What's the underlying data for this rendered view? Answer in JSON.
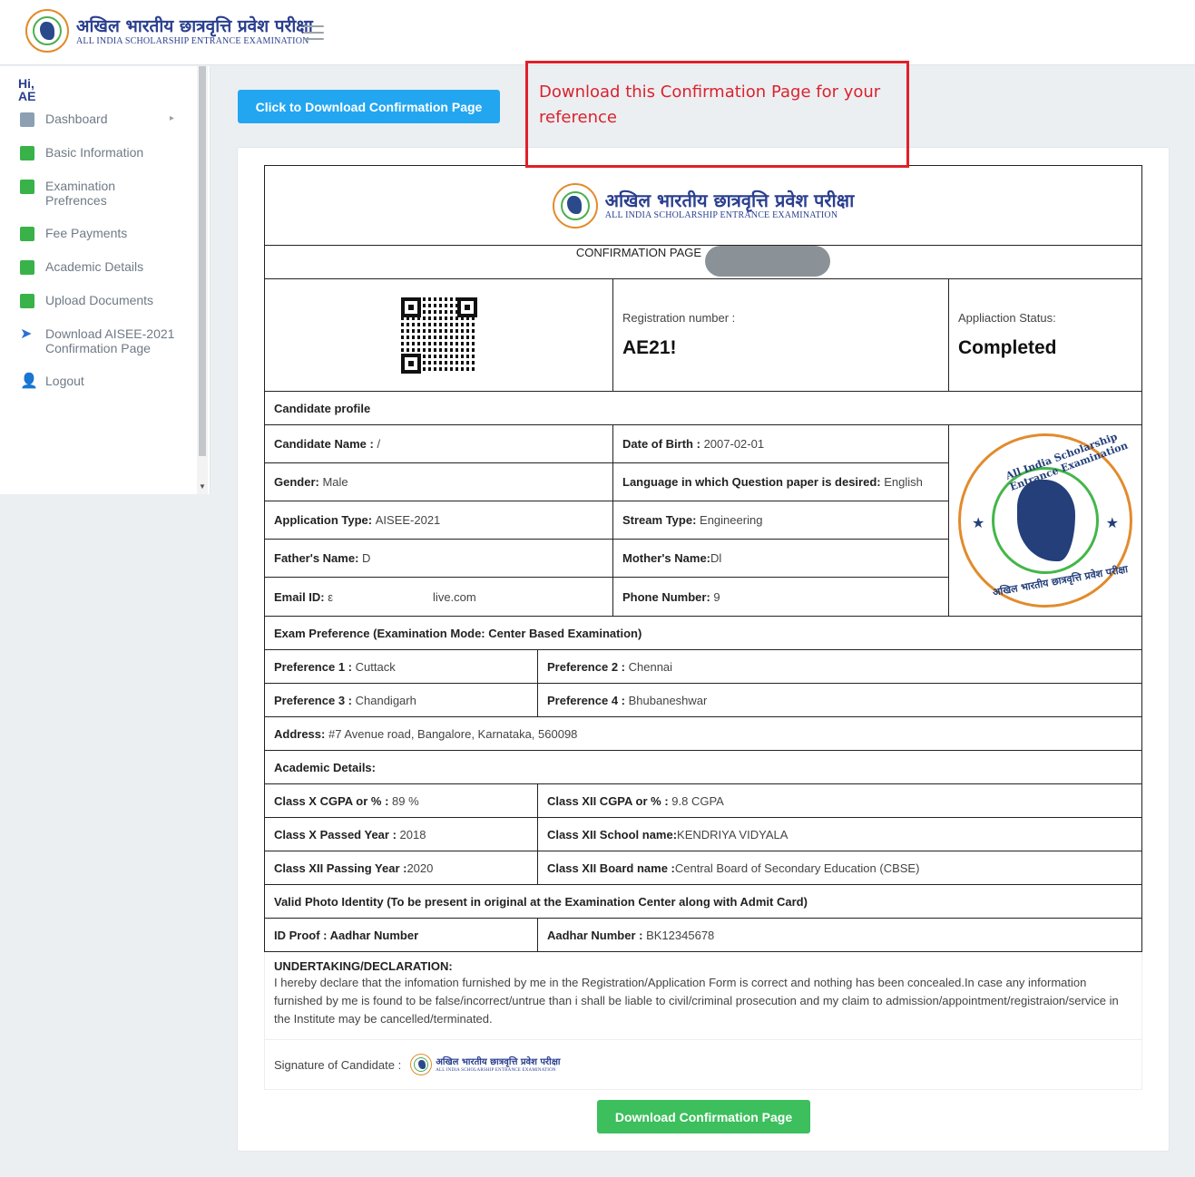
{
  "brand": {
    "hindi": "अखिल भारतीय छात्रवृत्ति प्रवेश परीक्षा",
    "english": "ALL INDIA SCHOLARSHIP ENTRANCE EXAMINATION"
  },
  "sidebar": {
    "greeting_hi": "Hi,",
    "greeting_name": "AE",
    "items": [
      {
        "label": "Dashboard",
        "icon": "dashboard-icon"
      },
      {
        "label": "Basic Information",
        "icon": "square-icon"
      },
      {
        "label": "Examination Prefrences",
        "icon": "square-icon"
      },
      {
        "label": "Fee Payments",
        "icon": "square-icon"
      },
      {
        "label": "Academic Details",
        "icon": "square-icon"
      },
      {
        "label": "Upload Documents",
        "icon": "square-icon"
      },
      {
        "label": "Download AISEE-2021 Confirmation Page",
        "icon": "paper-plane-icon"
      },
      {
        "label": "Logout",
        "icon": "user-icon"
      }
    ]
  },
  "main": {
    "download_top_label": "Click to Download Confirmation Page",
    "callout_text": "Download this Confirmation Page for your reference",
    "download_bottom_label": "Download Confirmation Page"
  },
  "doc": {
    "confirmation_label": "CONFIRMATION PAGE",
    "reg_label": "Registration number :",
    "reg_value": "AE21!",
    "status_label": "Appliaction Status:",
    "status_value": "Completed",
    "profile_heading": "Candidate profile",
    "profile": {
      "name_label": "Candidate Name :",
      "name_value": "/",
      "dob_label": "Date of Birth :",
      "dob_value": "2007-02-01",
      "gender_label": "Gender:",
      "gender_value": "Male",
      "lang_label": "Language in which Question paper is desired:",
      "lang_value": "English",
      "apptype_label": "Application Type:",
      "apptype_value": "AISEE-2021",
      "stream_label": "Stream Type:",
      "stream_value": "Engineering",
      "father_label": "Father's Name:",
      "father_value": "D",
      "mother_label": "Mother's Name:",
      "mother_value": "Dl",
      "email_label": "Email ID:",
      "email_value_start": "ε",
      "email_value_end": "live.com",
      "phone_label": "Phone Number:",
      "phone_value": "9"
    },
    "seal": {
      "outer_text": "All India Scholarship Entrance Examination",
      "hindi_text": "अखिल भारतीय छात्रवृत्ति प्रवेश परीक्षा"
    },
    "exam_pref_heading": "Exam Preference (Examination Mode: Center Based Examination)",
    "prefs": [
      {
        "label": "Preference 1 :",
        "value": "Cuttack"
      },
      {
        "label": "Preference 2 :",
        "value": "Chennai"
      },
      {
        "label": "Preference 3 :",
        "value": "Chandigarh"
      },
      {
        "label": "Preference 4 :",
        "value": "Bhubaneshwar"
      }
    ],
    "address_label": "Address:",
    "address_value": "#7 Avenue road, Bangalore, Karnataka, 560098",
    "academic_heading": "Academic Details:",
    "academic": {
      "x_cgpa_label": "Class X CGPA or % :",
      "x_cgpa_value": "89 %",
      "xii_cgpa_label": "Class XII CGPA or % :",
      "xii_cgpa_value": "9.8 CGPA",
      "x_year_label": "Class X Passed Year :",
      "x_year_value": "2018",
      "xii_school_label": "Class XII School name:",
      "xii_school_value": "KENDRIYA VIDYALA",
      "xii_year_label": "Class XII Passing Year :",
      "xii_year_value": "2020",
      "xii_board_label": "Class XII Board name :",
      "xii_board_value": "Central Board of Secondary Education (CBSE)"
    },
    "photo_id_heading": "Valid Photo Identity (To be present in original at the Examination Center along with Admit Card)",
    "id_proof_label": "ID Proof : Aadhar Number",
    "aadhar_label": "Aadhar Number :",
    "aadhar_value": "BK12345678",
    "declaration_title": "UNDERTAKING/DECLARATION:",
    "declaration_text": "I hereby declare that the infomation furnished by me in the Registration/Application Form is correct and nothing has been concealed.In case any information furnished by me is found to be false/incorrect/untrue than i shall be liable to civil/criminal prosecution and my claim to admission/appointment/registraion/service in the Institute may be cancelled/terminated.",
    "signature_label": "Signature of Candidate :"
  }
}
